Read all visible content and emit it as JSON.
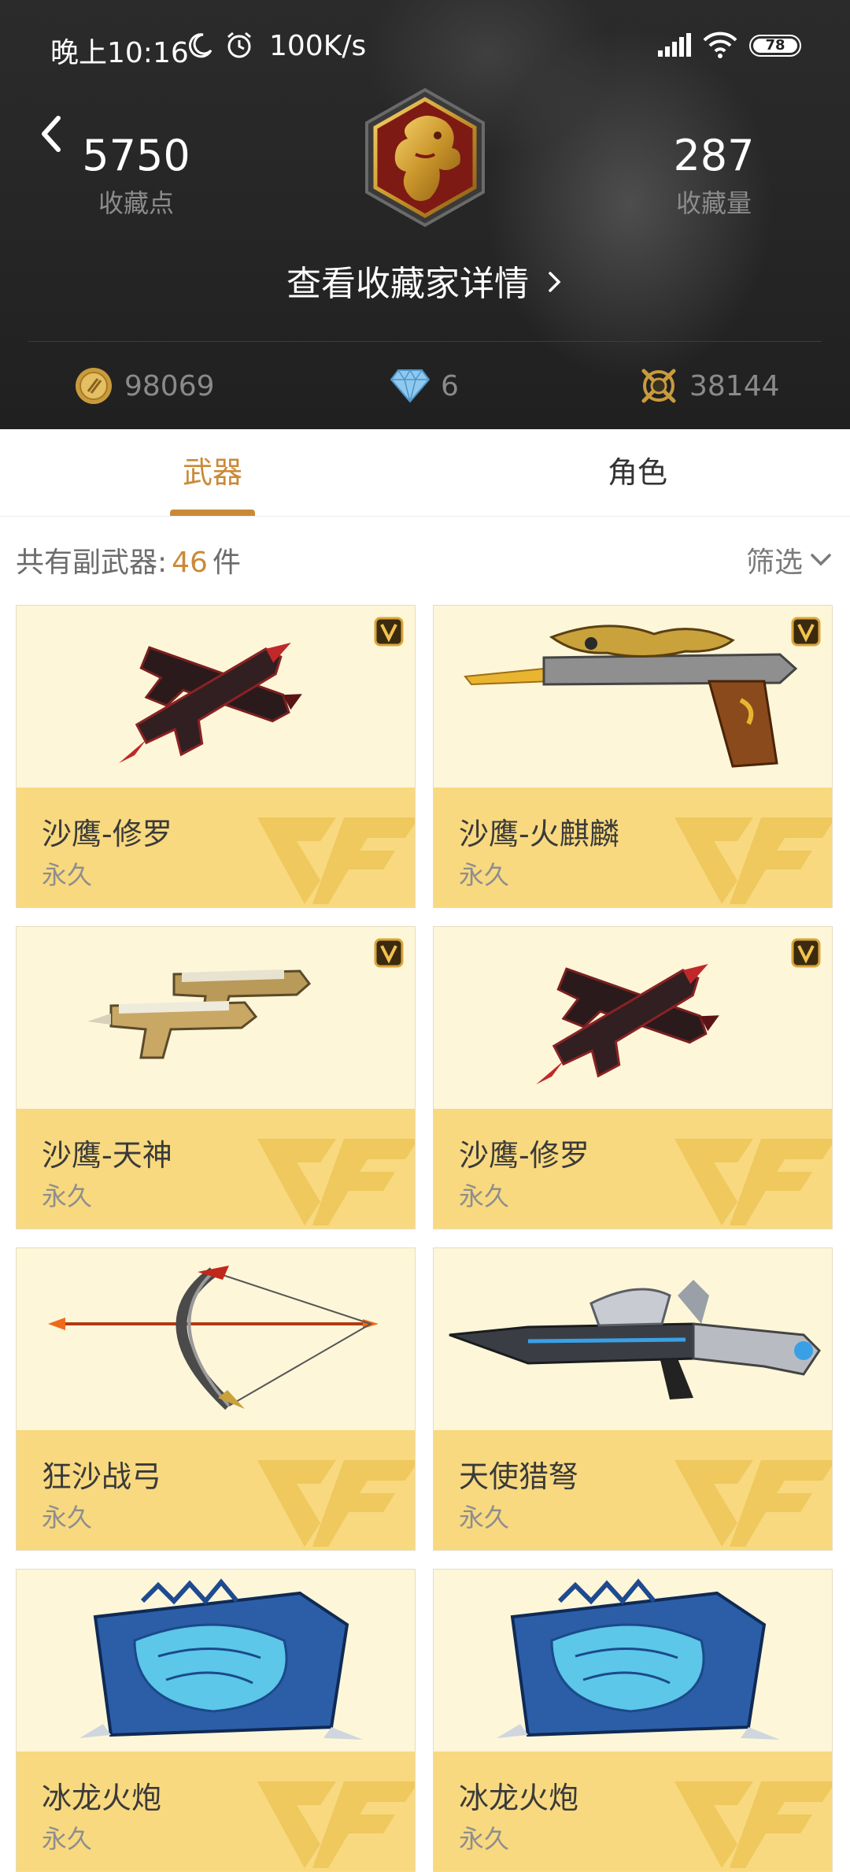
{
  "status": {
    "time": "晚上10:16",
    "speed": "100K/s",
    "battery": "78"
  },
  "header": {
    "left_stat": {
      "value": "5750",
      "label": "收藏点"
    },
    "right_stat": {
      "value": "287",
      "label": "收藏量"
    },
    "details_link": "查看收藏家详情",
    "currencies": [
      {
        "icon": "gold-coin-icon",
        "value": "98069"
      },
      {
        "icon": "diamond-icon",
        "value": "6"
      },
      {
        "icon": "crossed-swords-icon",
        "value": "38144"
      }
    ]
  },
  "tabs": [
    {
      "label": "武器",
      "active": true
    },
    {
      "label": "角色",
      "active": false
    }
  ],
  "summary": {
    "prefix": "共有副武器:",
    "count": "46",
    "unit": "件",
    "filter_label": "筛选"
  },
  "items": [
    {
      "name": "沙鹰-修罗",
      "duration": "永久",
      "vip": true,
      "icon": "dual-pistol-dark-icon"
    },
    {
      "name": "沙鹰-火麒麟",
      "duration": "永久",
      "vip": true,
      "icon": "golden-dragon-pistol-icon"
    },
    {
      "name": "沙鹰-天神",
      "duration": "永久",
      "vip": true,
      "icon": "dual-gold-pistol-icon"
    },
    {
      "name": "沙鹰-修罗",
      "duration": "永久",
      "vip": true,
      "icon": "dual-pistol-dark-icon"
    },
    {
      "name": "狂沙战弓",
      "duration": "永久",
      "vip": false,
      "icon": "bow-icon"
    },
    {
      "name": "天使猎弩",
      "duration": "永久",
      "vip": false,
      "icon": "crossbow-icon"
    },
    {
      "name": "冰龙火炮",
      "duration": "永久",
      "vip": false,
      "icon": "ice-dragon-cannon-icon"
    },
    {
      "name": "冰龙火炮",
      "duration": "永久",
      "vip": false,
      "icon": "ice-dragon-cannon-icon"
    }
  ],
  "colors": {
    "accent": "#c98a38",
    "card_bottom": "#f8d97f",
    "card_top": "#fdf6d8"
  }
}
